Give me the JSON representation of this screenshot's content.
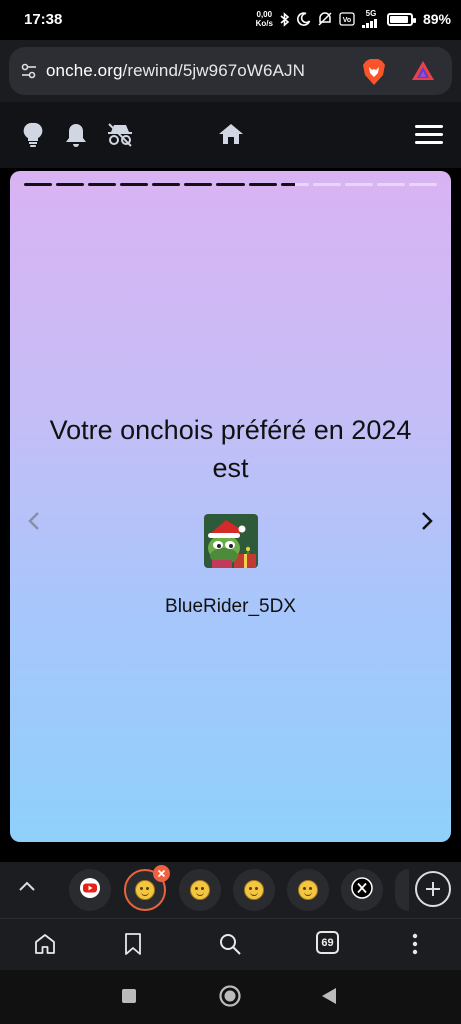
{
  "status_bar": {
    "time": "17:38",
    "net_speed_value": "0,00",
    "net_speed_unit": "Ko/s",
    "network": "5G",
    "battery_percent": "89%",
    "battery_level": 0.89
  },
  "browser": {
    "url_host": "onche.org",
    "url_path": "/rewind/5jw967oW6AJN",
    "tab_count": "69"
  },
  "site_header": {
    "icons": [
      "lightbulb-icon",
      "bell-icon",
      "incognito-icon",
      "home-icon",
      "hamburger-menu-icon"
    ]
  },
  "rewind": {
    "progress_segments": 13,
    "progress_filled": 8.5,
    "headline": "Votre onchois préféré en 2024 est",
    "username": "BlueRider_5DX"
  },
  "tab_strip": {
    "tabs": [
      "youtube",
      "onche-active",
      "onche",
      "onche",
      "onche",
      "x"
    ]
  },
  "colors": {
    "card_gradient_top": "#d9b3f3",
    "card_gradient_bottom": "#8fd0fb",
    "active_tab_ring": "#e8643a",
    "brave_orange": "#fb542b"
  }
}
